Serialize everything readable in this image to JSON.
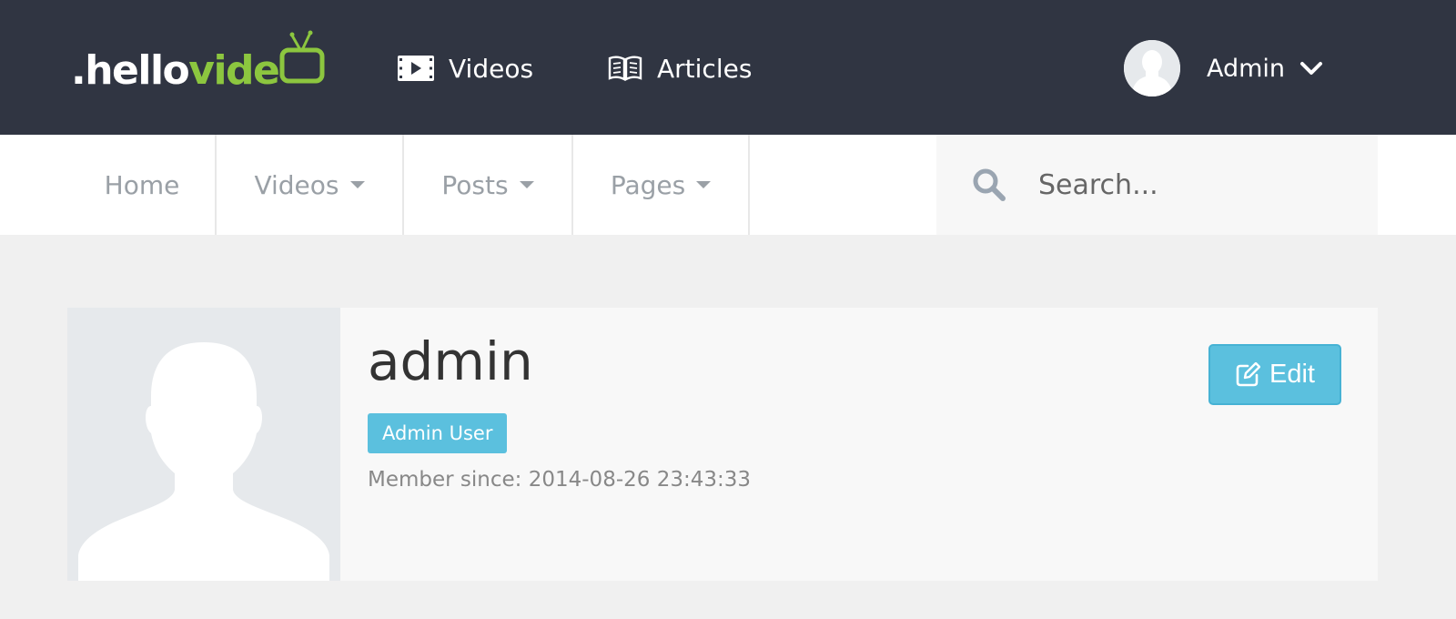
{
  "brand": {
    "logo_prefix": ".hello",
    "logo_suffix": "vide",
    "accent_color": "#8cc63f"
  },
  "topnav": {
    "items": [
      {
        "label": "Videos",
        "icon": "film-icon"
      },
      {
        "label": "Articles",
        "icon": "book-icon"
      }
    ],
    "user": {
      "name": "Admin",
      "avatar_icon": "user-avatar-icon",
      "menu_icon": "chevron-down-icon"
    }
  },
  "subnav": {
    "items": [
      {
        "label": "Home",
        "dropdown": false
      },
      {
        "label": "Videos",
        "dropdown": true
      },
      {
        "label": "Posts",
        "dropdown": true
      },
      {
        "label": "Pages",
        "dropdown": true
      }
    ],
    "search": {
      "placeholder": "Search...",
      "value": "",
      "icon": "search-icon"
    }
  },
  "profile": {
    "username": "admin",
    "role": "Admin User",
    "member_since": "Member since: 2014-08-26 23:43:33",
    "edit_label": "Edit",
    "edit_icon": "edit-icon",
    "badge_color": "#5bc0de"
  }
}
